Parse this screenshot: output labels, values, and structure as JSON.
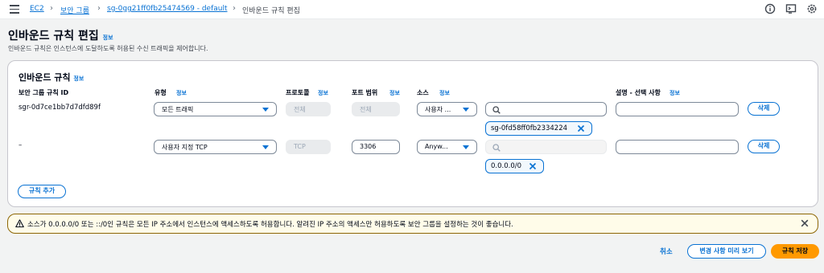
{
  "breadcrumbs": {
    "ec2": "EC2",
    "security_groups": "보안 그룹",
    "sg": "sg-0gg21ff0fb25474569 - default",
    "current": "인바운드 규칙 편집"
  },
  "header": {
    "title": "인바운드 규칙 편집",
    "info": "정보",
    "description": "인바운드 규칙은 인스턴스에 도달하도록 허용된 수신 트래픽을 제어합니다."
  },
  "panel": {
    "title": "인바운드 규칙",
    "info": "정보",
    "columns": {
      "rule_id": "보안 그룹 규칙 ID",
      "type": "유형",
      "protocol": "프로토콜",
      "port_range": "포트 범위",
      "source": "소스",
      "description": "설명 - 선택 사항",
      "info": "정보"
    },
    "rows": [
      {
        "rule_id": "sgr-0d7ce1bb7d7dfd89f",
        "type": "모든 트래픽",
        "protocol": "전체",
        "port_range": "전체",
        "source": "사용자 ...",
        "search_value": "",
        "token": "sg-0fd58ff0fb2334224",
        "description": "",
        "delete": "삭제"
      },
      {
        "rule_id": "–",
        "type": "사용자 지정 TCP",
        "protocol": "TCP",
        "port_range": "3306",
        "source": "Anyw...",
        "search_value": "",
        "token": "0.0.0.0/0",
        "description": "",
        "delete": "삭제"
      }
    ],
    "add_rule": "규칙 추가"
  },
  "warning": {
    "text": "소스가 0.0.0.0/0 또는 ::/0인 규칙은 모든 IP 주소에서 인스턴스에 액세스하도록 허용합니다. 알려진 IP 주소의 액세스만 허용하도록 보안 그룹을 설정하는 것이 좋습니다."
  },
  "footer": {
    "cancel": "취소",
    "preview": "변경 사항 미리 보기",
    "save": "규칙 저장"
  },
  "colors": {
    "accent": "#0972d3",
    "primary_button": "#ff9900",
    "warning_border": "#8d6605",
    "warning_bg": "#fffce9"
  },
  "icons": [
    "menu-icon",
    "info-circle-icon",
    "terminal-icon",
    "settings-icon",
    "caret-down-icon",
    "search-icon",
    "close-icon",
    "warning-icon"
  ]
}
